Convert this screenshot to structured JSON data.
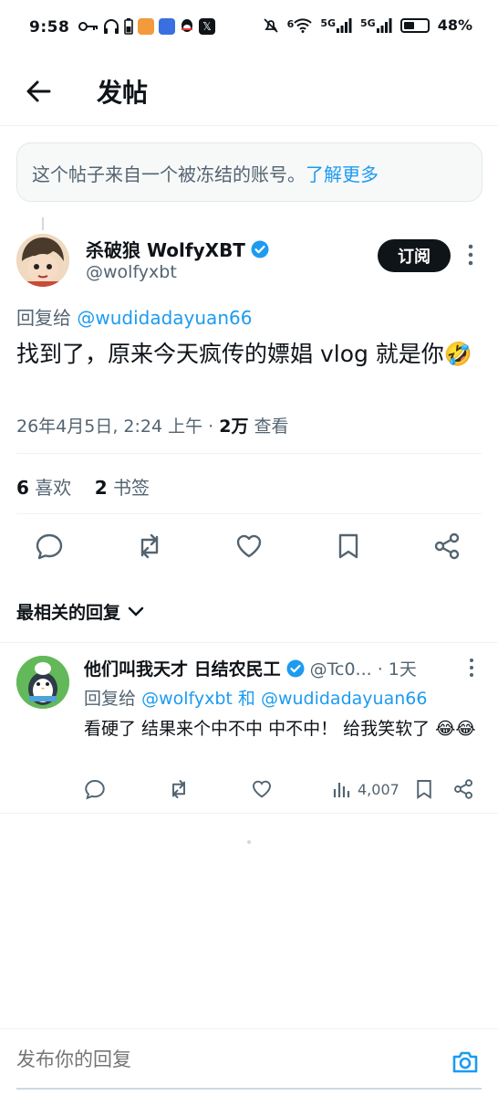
{
  "status_bar": {
    "time": "9:58",
    "network_labels": [
      "6",
      "5G",
      "5G"
    ],
    "battery_percent": "48%",
    "battery_level": 0.48,
    "icons": [
      "key-icon",
      "headphones-icon",
      "battery-small-icon",
      "app-orange-icon",
      "app-blue-icon",
      "qq-icon",
      "x-icon",
      "mute-icon",
      "wifi-icon",
      "signal-icon",
      "signal-icon",
      "battery-icon"
    ]
  },
  "header": {
    "title": "发帖"
  },
  "notice": {
    "text": "这个帖子来自一个被冻结的账号。",
    "link": "了解更多"
  },
  "post": {
    "author_name": "杀破狼 WolfyXBT",
    "handle": "@wolfyxbt",
    "subscribe_label": "订阅",
    "reply_prefix": "回复给",
    "reply_target": "@wudidadayuan66",
    "text": "找到了，原来今天疯传的嫖娼 vlog 就是你🤣",
    "timestamp": "26年4月5日, 2:24 上午 · ",
    "views_count": "2万",
    "views_label": " 查看",
    "likes_count": "6",
    "likes_label": "喜欢",
    "bookmarks_count": "2",
    "bookmarks_label": "书签"
  },
  "actions": [
    "reply-icon",
    "retweet-icon",
    "like-icon",
    "bookmark-icon",
    "share-icon"
  ],
  "sort_label": "最相关的回复",
  "reply": {
    "author_name": "他们叫我天才 日结农民工",
    "handle_time": "@Tc0... · 1天",
    "reply_prefix": "回复给",
    "reply_target_1": "@wolfyxbt",
    "and": " 和 ",
    "reply_target_2": "@wudidadayuan66",
    "text": "看硬了 结果来个中不中  中不中！ 给我笑软了 😂😂",
    "views": "4,007"
  },
  "compose": {
    "placeholder": "发布你的回复"
  },
  "colors": {
    "accent": "#1d9bf0",
    "text": "#0f1419",
    "muted": "#536471",
    "border": "#eff3f4"
  }
}
